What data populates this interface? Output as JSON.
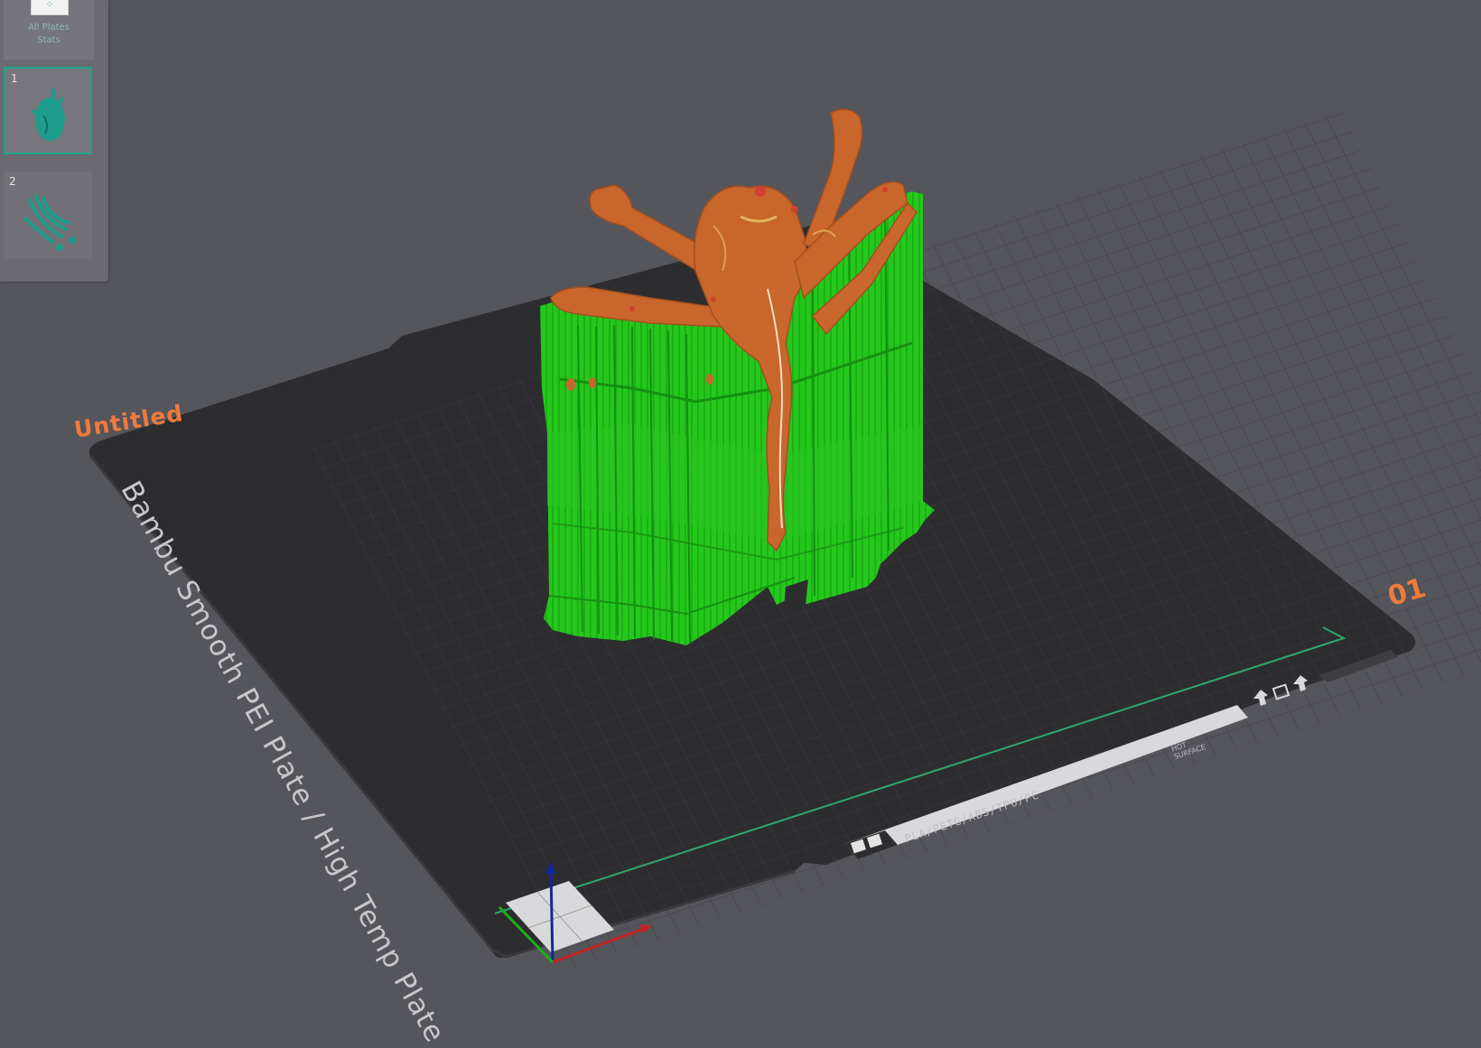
{
  "plate_panel": {
    "all_plates_label": "All Plates\nStats",
    "plates": [
      {
        "number": "1",
        "selected": true
      },
      {
        "number": "2",
        "selected": false
      }
    ]
  },
  "build_plate": {
    "title": "Untitled",
    "plate_number": "01",
    "plate_type": "Bambu Smooth PEI Plate / High Temp Plate",
    "materials": "PLA/PETG/ABS/TPU/PC",
    "warning": "HOT\nSURFACE"
  },
  "colors": {
    "background": "#55555c",
    "plate": "#2d2d30",
    "support": "#22c41a",
    "model": "#c8662c",
    "accent_orange": "#f07a3c",
    "teal": "#1ea38c"
  }
}
